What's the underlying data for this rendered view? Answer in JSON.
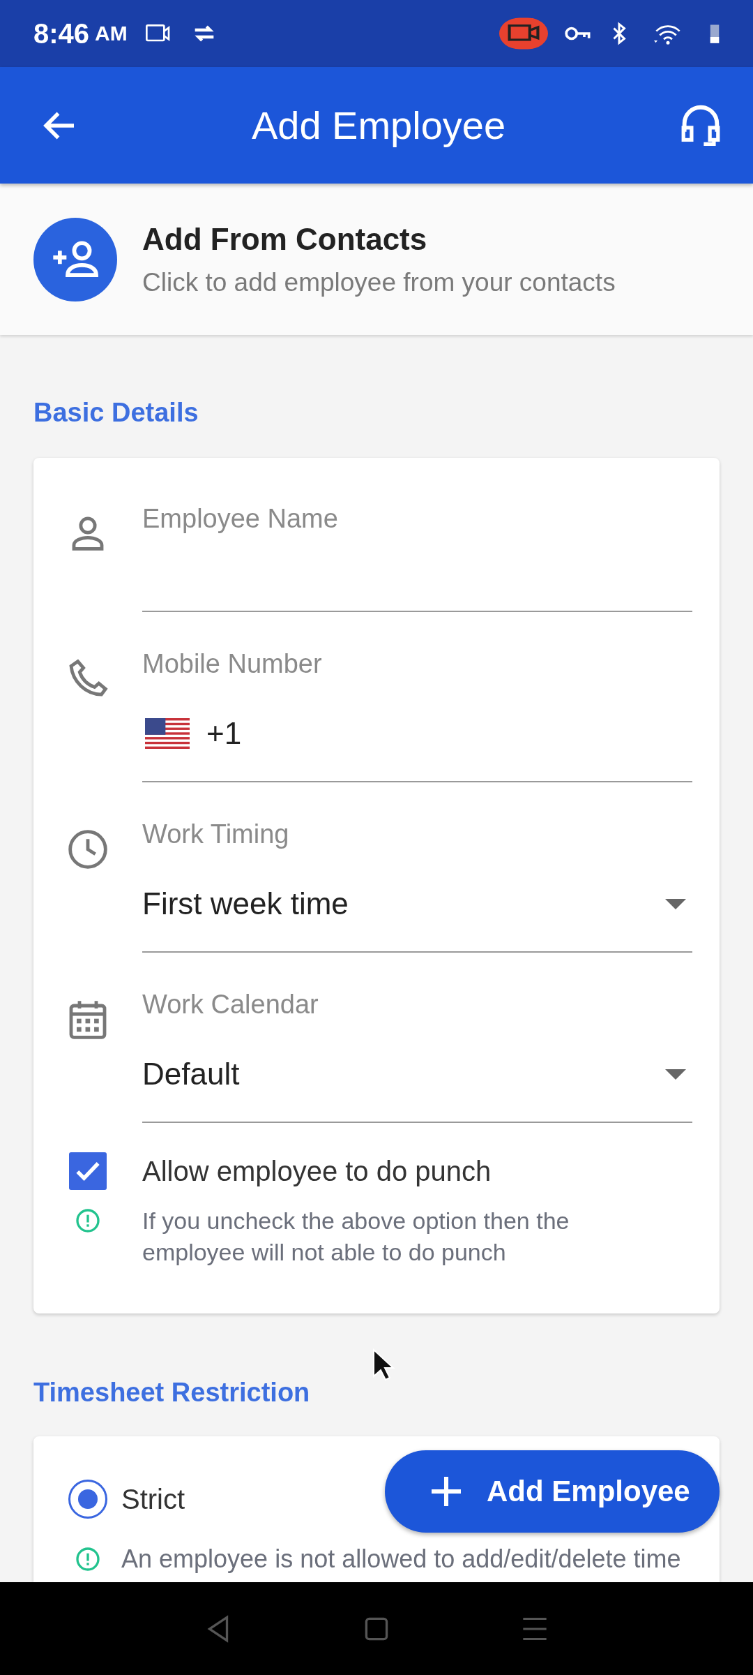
{
  "status_bar": {
    "time": "8:46",
    "meridiem": "AM"
  },
  "app_bar": {
    "title": "Add Employee"
  },
  "contacts": {
    "title": "Add From Contacts",
    "subtitle": "Click to add employee from your contacts"
  },
  "basic_details": {
    "heading": "Basic Details",
    "fields": [
      {
        "kind": "text",
        "label": "Employee Name"
      },
      {
        "kind": "phone",
        "label": "Mobile Number",
        "value": "+1"
      },
      {
        "kind": "select",
        "label": "Work Timing",
        "value": "First week time"
      },
      {
        "kind": "select",
        "label": "Work Calendar",
        "value": "Default"
      }
    ],
    "punch": {
      "label": "Allow employee to do punch",
      "checked": true,
      "note": "If you uncheck the above option then the employee will not able to do punch"
    }
  },
  "timesheet_restriction": {
    "heading": "Timesheet Restriction",
    "options": [
      {
        "label": "Strict",
        "selected": true,
        "note": "An employee is not allowed to add/edit/delete time"
      }
    ]
  },
  "fab": {
    "label": "Add Employee"
  }
}
